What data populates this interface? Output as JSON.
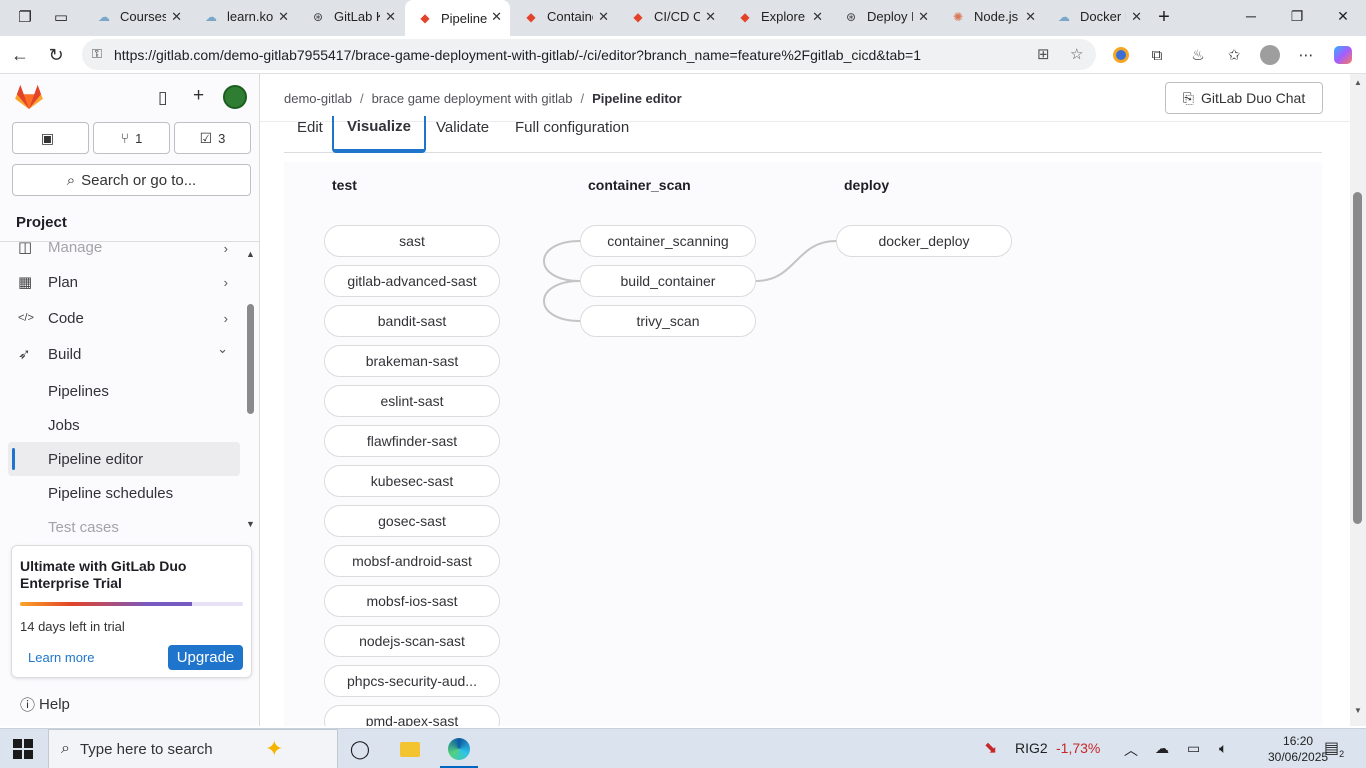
{
  "browser": {
    "tabs": [
      {
        "label": "Courses",
        "icon": "cloud-icon"
      },
      {
        "label": "learn.ko",
        "icon": "cloud-icon"
      },
      {
        "label": "GitLab K",
        "icon": "openai-icon"
      },
      {
        "label": "Pipeline",
        "icon": "gitlab-icon",
        "active": true
      },
      {
        "label": "Containe",
        "icon": "gitlab-icon"
      },
      {
        "label": "CI/CD Co",
        "icon": "gitlab-icon"
      },
      {
        "label": "Explore",
        "icon": "gitlab-icon"
      },
      {
        "label": "Deploy H",
        "icon": "openai-icon"
      },
      {
        "label": "Node.js",
        "icon": "claude-icon"
      },
      {
        "label": "Docker I",
        "icon": "cloud-icon"
      }
    ],
    "url": "https://gitlab.com/demo-gitlab7955417/brace-game-deployment-with-gitlab/-/ci/editor?branch_name=feature%2Fgitlab_cicd&tab=1"
  },
  "sidebar": {
    "counters": [
      {
        "icon": "issues-icon",
        "value": ""
      },
      {
        "icon": "merge-request-icon",
        "value": "1"
      },
      {
        "icon": "todo-icon",
        "value": "3"
      }
    ],
    "search_label": "Search or go to...",
    "section_title": "Project",
    "nav": [
      {
        "label": "Manage",
        "icon": "manage-icon",
        "faded": true
      },
      {
        "label": "Plan",
        "icon": "plan-icon"
      },
      {
        "label": "Code",
        "icon": "code-icon"
      },
      {
        "label": "Build",
        "icon": "rocket-icon",
        "expanded": true
      }
    ],
    "subnav": [
      {
        "label": "Pipelines"
      },
      {
        "label": "Jobs"
      },
      {
        "label": "Pipeline editor",
        "active": true
      },
      {
        "label": "Pipeline schedules"
      },
      {
        "label": "Test cases",
        "faded": true
      }
    ],
    "trial": {
      "title": "Ultimate with GitLab Duo Enterprise Trial",
      "days_left": "14 days left in trial",
      "progress": 0.77,
      "learn_more": "Learn more",
      "upgrade": "Upgrade"
    },
    "help": "Help"
  },
  "header": {
    "breadcrumbs": [
      "demo-gitlab",
      "brace game deployment with gitlab",
      "Pipeline editor"
    ],
    "duo_chat": "GitLab Duo Chat"
  },
  "editor_tabs": [
    "Edit",
    "Visualize",
    "Validate",
    "Full configuration"
  ],
  "pipeline": {
    "stages": [
      {
        "name": "test",
        "jobs": [
          "sast",
          "gitlab-advanced-sast",
          "bandit-sast",
          "brakeman-sast",
          "eslint-sast",
          "flawfinder-sast",
          "kubesec-sast",
          "gosec-sast",
          "mobsf-android-sast",
          "mobsf-ios-sast",
          "nodejs-scan-sast",
          "phpcs-security-aud...",
          "pmd-apex-sast"
        ]
      },
      {
        "name": "container_scan",
        "jobs": [
          "container_scanning",
          "build_container",
          "trivy_scan"
        ]
      },
      {
        "name": "deploy",
        "jobs": [
          "docker_deploy"
        ]
      }
    ],
    "needs": [
      {
        "from": "build_container",
        "to": "container_scanning"
      },
      {
        "from": "build_container",
        "to": "trivy_scan"
      },
      {
        "from": "build_container",
        "to": "docker_deploy"
      }
    ]
  },
  "taskbar": {
    "search_placeholder": "Type here to search",
    "stock_name": "RIG2",
    "stock_change": "-1,73%",
    "time": "16:20",
    "date": "30/06/2025",
    "notifications": "2"
  },
  "colors": {
    "accent": "#1f75cb",
    "gitlab_orange": "#e24329",
    "stock_negative": "#c62828"
  }
}
